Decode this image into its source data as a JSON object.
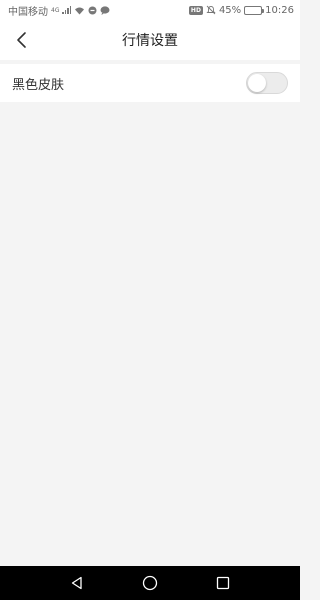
{
  "status_bar": {
    "carrier": "中国移动",
    "signal_type": "4G",
    "battery_percent": "45%",
    "time": "10:26",
    "hd_badge": "HD",
    "icons": [
      "signal-icon",
      "wifi-icon",
      "vpn-icon",
      "message-icon",
      "hd-icon",
      "mute-icon",
      "battery-icon"
    ]
  },
  "header": {
    "title": "行情设置",
    "back_icon": "chevron-left-icon"
  },
  "settings": [
    {
      "label": "黑色皮肤",
      "enabled": false
    }
  ],
  "nav_bar": {
    "icons": [
      "back-triangle-icon",
      "home-circle-icon",
      "recents-square-icon"
    ]
  },
  "colors": {
    "background": "#f4f4f4",
    "surface": "#ffffff",
    "nav_bar": "#000000",
    "toggle_off": "#ececec"
  }
}
